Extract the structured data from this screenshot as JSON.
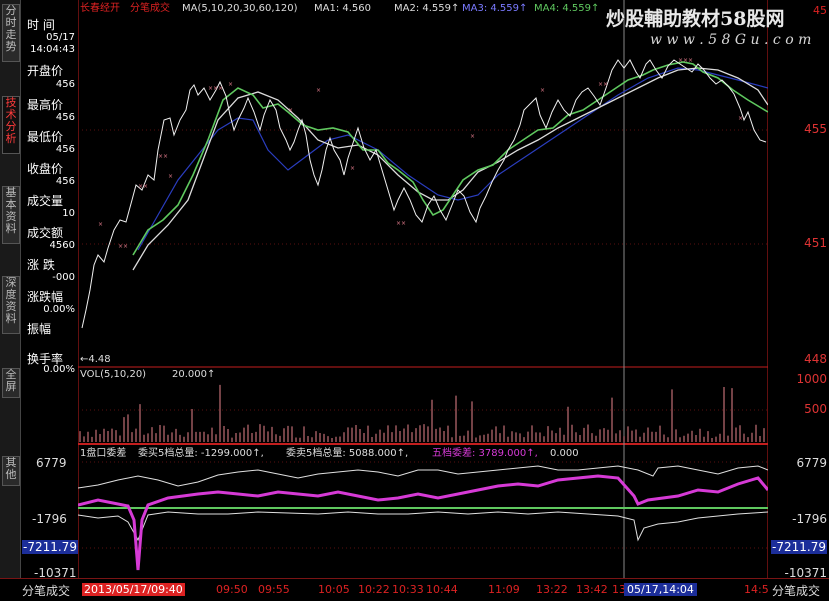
{
  "left_tabs": [
    {
      "label": "分时走势",
      "active": false
    },
    {
      "label": "技术分析",
      "active": true
    },
    {
      "label": "基本资料",
      "active": false
    },
    {
      "label": "深度资料",
      "active": false
    },
    {
      "label": "全屏",
      "active": false
    },
    {
      "label": "其他",
      "active": false
    }
  ],
  "info_panel": {
    "time_label": "时 间",
    "date": "05/17",
    "time": "14:04:43",
    "fields": [
      {
        "label": "开盘价",
        "value": "456"
      },
      {
        "label": "最高价",
        "value": "456"
      },
      {
        "label": "最低价",
        "value": "456"
      },
      {
        "label": "收盘价",
        "value": "456"
      },
      {
        "label": "成交量",
        "value": "10"
      },
      {
        "label": "成交额",
        "value": "4560"
      },
      {
        "label": "涨 跌",
        "value": "-000"
      },
      {
        "label": "涨跌幅",
        "value": "0.00%"
      },
      {
        "label": "振幅",
        "value": ""
      },
      {
        "label": "换手率",
        "value": "0.00%"
      }
    ]
  },
  "price_header": {
    "stock_name": "长春经开",
    "mode": "分笔成交",
    "ma_params": "MA(5,10,20,30,60,120)",
    "ma1": "MA1: 4.560",
    "ma2": "MA2: 4.559↑",
    "ma3": "MA3: 4.559↑",
    "ma4": "MA4: 4.559↑",
    "top_value": "45"
  },
  "watermark": {
    "line1": "炒股輔助教材58股网",
    "line2": "w w w . 5 8 G u . c o m"
  },
  "price_axis": [
    "455",
    "451",
    "448"
  ],
  "price_low_marker": "←4.48",
  "vol_header": {
    "label": "VOL(5,10,20)",
    "value": "20.000↑"
  },
  "vol_axis": [
    "1000",
    "500",
    "1000",
    "500"
  ],
  "ind_header": {
    "title": "1盘口委差",
    "buy": "委买5档总量: -1299.000↑,",
    "sell": "委卖5档总量: 5088.000↑,",
    "diff": "五档委差: 3789.000↑,",
    "zero": "0.000"
  },
  "ind_axis": {
    "top": "6779",
    "mid": "-1796",
    "box": "-7211.79",
    "bottom": "-10371"
  },
  "bottom_bar": {
    "left_label": "分笔成交",
    "times": [
      "2013/05/17/09:40",
      "09:50",
      "09:55",
      "10:05",
      "10:22",
      "10:33",
      "10:44",
      "11:09",
      "13:22",
      "13:42",
      "13",
      "05/17,14:04",
      "14:5"
    ],
    "right_label": "分笔成交"
  },
  "colors": {
    "price": "#e8e8e8",
    "ma_green": "#5fc85f",
    "ma_white": "#dcdcdc",
    "ma_blue": "#2a3dbf",
    "vol": "#e8838c",
    "indicator": "#d63ad6",
    "axis": "#c41e1e"
  }
}
